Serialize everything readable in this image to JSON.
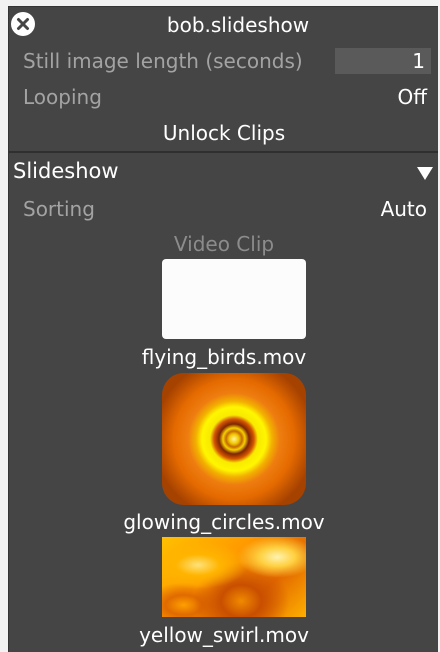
{
  "panel": {
    "title": "bob.slideshow",
    "close_icon": "close-icon"
  },
  "settings": {
    "still_image_length_label": "Still image length (seconds)",
    "still_image_length_value": "1",
    "looping_label": "Looping",
    "looping_value": "Off",
    "unlock_clips_label": "Unlock Clips"
  },
  "slideshow": {
    "section_title": "Slideshow",
    "collapse_icon": "triangle-down-icon",
    "sorting_label": "Sorting",
    "sorting_value": "Auto",
    "column_header": "Video Clip",
    "clips": [
      {
        "name": "flying_birds.mov",
        "thumbnail": "blank-white-thumbnail"
      },
      {
        "name": "glowing_circles.mov",
        "thumbnail": "concentric-circles-thumbnail"
      },
      {
        "name": "yellow_swirl.mov",
        "thumbnail": "yellow-swirl-thumbnail"
      }
    ]
  }
}
